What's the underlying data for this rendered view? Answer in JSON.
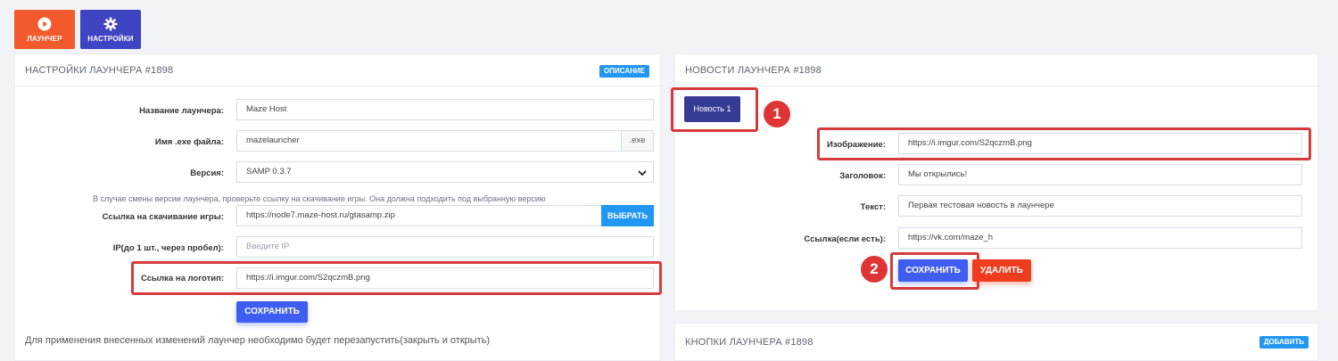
{
  "topbar": {
    "launcher_label": "ЛАУНЧЕР",
    "settings_label": "НАСТРОЙКИ"
  },
  "settings_card": {
    "title": "НАСТРОЙКИ ЛАУНЧЕРА #1898",
    "badge": "ОПИСАНИЕ",
    "name_label": "Название лаунчера:",
    "name_value": "Maze Host",
    "exe_label": "Имя .exe файла:",
    "exe_value": "mazelauncher",
    "exe_suffix": ".exe",
    "version_label": "Версия:",
    "version_value": "SAMP 0.3.7",
    "version_hint": "В случае смены версии лаунчера, проверьте ссылку на скачивание игры. Она должна подходить под выбранную версию",
    "download_label": "Ссылка на скачивание игры:",
    "download_value": "https://node7.maze-host.ru/gtasamp.zip",
    "choose_button": "ВЫБРАТЬ",
    "ip_label": "IP(до 1 шт., через пробел):",
    "ip_placeholder": "Введите IP",
    "logo_label": "Ссылка на логотип:",
    "logo_value": "https://i.imgur.com/S2qczmB.png",
    "save_button": "СОХРАНИТЬ",
    "restart_note": "Для применения внесенных изменений лаунчер необходимо будет перезапустить(закрыть и открыть)"
  },
  "news_card": {
    "title": "НОВОСТИ ЛАУНЧЕРА #1898",
    "news_tab": "Новость 1",
    "image_label": "Изображение:",
    "image_value": "https://i.imgur.com/S2qczmB.png",
    "heading_label": "Заголовок:",
    "heading_value": "Мы открылись!",
    "text_label": "Текст:",
    "text_value": "Первая тестовая новость в лаунчере",
    "link_label": "Ссылка(если есть):",
    "link_value": "https://vk.com/maze_h",
    "save_button": "СОХРАНИТЬ",
    "delete_button": "УДАЛИТЬ"
  },
  "buttons_card": {
    "title": "КНОПКИ ЛАУНЧЕРА #1898",
    "badge": "ДОБАВИТЬ"
  },
  "markers": {
    "one": "1",
    "two": "2"
  },
  "colors": {
    "launcher_button": "#f25a2c",
    "settings_button": "#3f44c2",
    "accent_blue": "#2196f3",
    "save_blue": "#3f5df0",
    "delete_red": "#ee3d1e",
    "highlight_red": "#d63a3a"
  }
}
